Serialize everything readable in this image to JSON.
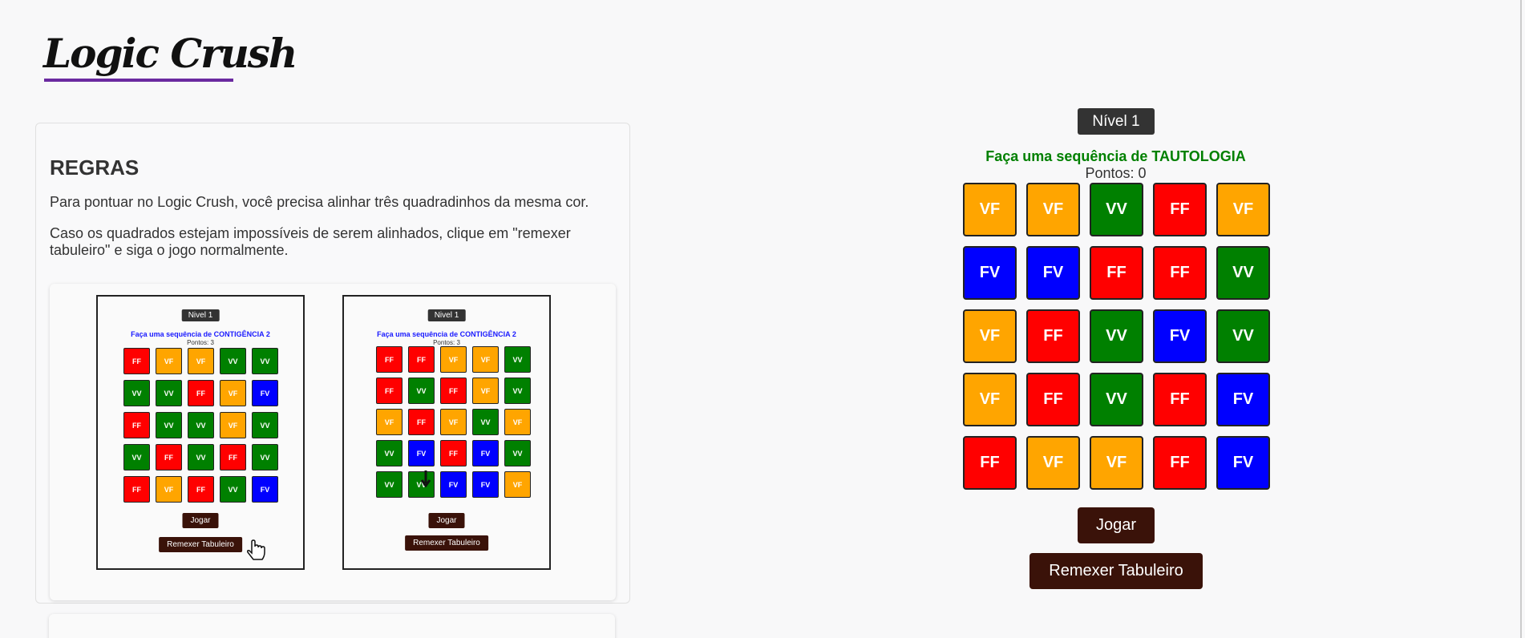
{
  "logo": "Logic Crush",
  "rules": {
    "title": "REGRAS",
    "p1": "Para pontuar no Logic Crush, você precisa alinhar três quadradinhos da mesma cor.",
    "p2": "Caso os quadrados estejam impossíveis de serem alinhados, clique em \"remexer tabuleiro\" e siga o jogo normalmente."
  },
  "example1": {
    "level": "Nivel 1",
    "goal": "Faça uma sequência de CONTIGÊNCIA 2",
    "score": "Pontos: 3",
    "tiles": [
      "FF",
      "VF",
      "VF",
      "VV",
      "VV",
      "VV",
      "VV",
      "FF",
      "VF",
      "FV",
      "FF",
      "VV",
      "VV",
      "VF",
      "VV",
      "VV",
      "FF",
      "VV",
      "FF",
      "VV",
      "FF",
      "VF",
      "FF",
      "VV",
      "FV"
    ],
    "play": "Jogar",
    "shuffle": "Remexer Tabuleiro"
  },
  "example2": {
    "level": "Nivel 1",
    "goal": "Faça uma sequência de CONTIGÊNCIA 2",
    "score": "Pontos: 3",
    "tiles": [
      "FF",
      "FF",
      "VF",
      "VF",
      "VV",
      "FF",
      "VV",
      "FF",
      "VF",
      "VV",
      "VF",
      "FF",
      "VF",
      "VV",
      "VF",
      "VV",
      "FV",
      "FF",
      "FV",
      "VV",
      "VV",
      "VV",
      "FV",
      "FV",
      "VF"
    ],
    "play": "Jogar",
    "shuffle": "Remexer Tabuleiro"
  },
  "game": {
    "level": "Nível 1",
    "goal": "Faça uma sequência de TAUTOLOGIA",
    "score": "Pontos: 0",
    "tiles": [
      "VF",
      "VF",
      "VV",
      "FF",
      "VF",
      "FV",
      "FV",
      "FF",
      "FF",
      "VV",
      "VF",
      "FF",
      "VV",
      "FV",
      "VV",
      "VF",
      "FF",
      "VV",
      "FF",
      "FV",
      "FF",
      "VF",
      "VF",
      "FF",
      "FV"
    ],
    "play": "Jogar",
    "shuffle": "Remexer Tabuleiro"
  },
  "colors": {
    "VF": "#ffa500",
    "VV": "#008000",
    "FF": "#ff0000",
    "FV": "#0000ff",
    "accent_underline": "#6a2aa0",
    "button": "#3a1209"
  }
}
